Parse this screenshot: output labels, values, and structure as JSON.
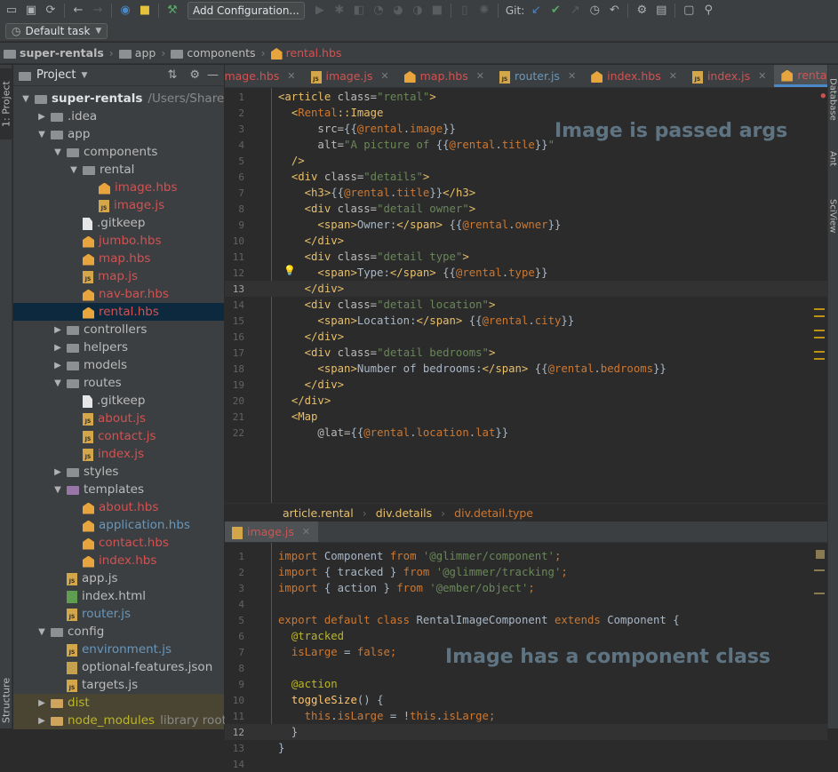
{
  "toolbar": {
    "add_configuration": "Add Configuration...",
    "git_label": "Git:"
  },
  "task": {
    "label": "Default task"
  },
  "breadcrumb": [
    "super-rentals",
    "app",
    "components",
    "rental.hbs"
  ],
  "left_strip": {
    "project_tab": "1: Project",
    "structure_tab": "Structure"
  },
  "right_strip": {
    "database": "Database",
    "ant": "Ant",
    "sciview": "SciView"
  },
  "project_panel": {
    "title": "Project"
  },
  "tree": [
    {
      "label": "super-rentals",
      "extra": "/Users/Shared/",
      "depth": 0,
      "arrow": "open",
      "icon": "folder",
      "color": "bold"
    },
    {
      "label": ".idea",
      "depth": 1,
      "arrow": "closed",
      "icon": "folder",
      "color": "plain"
    },
    {
      "label": "app",
      "depth": 1,
      "arrow": "open",
      "icon": "folder",
      "color": "plain"
    },
    {
      "label": "components",
      "depth": 2,
      "arrow": "open",
      "icon": "folder",
      "color": "plain"
    },
    {
      "label": "rental",
      "depth": 3,
      "arrow": "open",
      "icon": "folder",
      "color": "plain"
    },
    {
      "label": "image.hbs",
      "depth": 4,
      "arrow": "none",
      "icon": "hbs",
      "color": "red"
    },
    {
      "label": "image.js",
      "depth": 4,
      "arrow": "none",
      "icon": "js",
      "color": "red"
    },
    {
      "label": ".gitkeep",
      "depth": 3,
      "arrow": "none",
      "icon": "plain",
      "color": "plain"
    },
    {
      "label": "jumbo.hbs",
      "depth": 3,
      "arrow": "none",
      "icon": "hbs",
      "color": "red"
    },
    {
      "label": "map.hbs",
      "depth": 3,
      "arrow": "none",
      "icon": "hbs",
      "color": "red"
    },
    {
      "label": "map.js",
      "depth": 3,
      "arrow": "none",
      "icon": "js",
      "color": "red"
    },
    {
      "label": "nav-bar.hbs",
      "depth": 3,
      "arrow": "none",
      "icon": "hbs",
      "color": "red"
    },
    {
      "label": "rental.hbs",
      "depth": 3,
      "arrow": "none",
      "icon": "hbs",
      "color": "red",
      "selected": true
    },
    {
      "label": "controllers",
      "depth": 2,
      "arrow": "closed",
      "icon": "folder",
      "color": "plain"
    },
    {
      "label": "helpers",
      "depth": 2,
      "arrow": "closed",
      "icon": "folder",
      "color": "plain"
    },
    {
      "label": "models",
      "depth": 2,
      "arrow": "closed",
      "icon": "folder",
      "color": "plain"
    },
    {
      "label": "routes",
      "depth": 2,
      "arrow": "open",
      "icon": "folder",
      "color": "plain"
    },
    {
      "label": ".gitkeep",
      "depth": 3,
      "arrow": "none",
      "icon": "plain",
      "color": "plain"
    },
    {
      "label": "about.js",
      "depth": 3,
      "arrow": "none",
      "icon": "js",
      "color": "red"
    },
    {
      "label": "contact.js",
      "depth": 3,
      "arrow": "none",
      "icon": "js",
      "color": "red"
    },
    {
      "label": "index.js",
      "depth": 3,
      "arrow": "none",
      "icon": "js",
      "color": "red"
    },
    {
      "label": "styles",
      "depth": 2,
      "arrow": "closed",
      "icon": "folder",
      "color": "plain"
    },
    {
      "label": "templates",
      "depth": 2,
      "arrow": "open",
      "icon": "folder-purple",
      "color": "plain"
    },
    {
      "label": "about.hbs",
      "depth": 3,
      "arrow": "none",
      "icon": "hbs",
      "color": "red"
    },
    {
      "label": "application.hbs",
      "depth": 3,
      "arrow": "none",
      "icon": "hbs",
      "color": "blue"
    },
    {
      "label": "contact.hbs",
      "depth": 3,
      "arrow": "none",
      "icon": "hbs",
      "color": "red"
    },
    {
      "label": "index.hbs",
      "depth": 3,
      "arrow": "none",
      "icon": "hbs",
      "color": "red"
    },
    {
      "label": "app.js",
      "depth": 2,
      "arrow": "none",
      "icon": "js",
      "color": "plain"
    },
    {
      "label": "index.html",
      "depth": 2,
      "arrow": "none",
      "icon": "html",
      "color": "plain"
    },
    {
      "label": "router.js",
      "depth": 2,
      "arrow": "none",
      "icon": "js",
      "color": "blue"
    },
    {
      "label": "config",
      "depth": 1,
      "arrow": "open",
      "icon": "folder",
      "color": "plain"
    },
    {
      "label": "environment.js",
      "depth": 2,
      "arrow": "none",
      "icon": "js",
      "color": "blue"
    },
    {
      "label": "optional-features.json",
      "depth": 2,
      "arrow": "none",
      "icon": "json",
      "color": "plain"
    },
    {
      "label": "targets.js",
      "depth": 2,
      "arrow": "none",
      "icon": "js",
      "color": "plain"
    },
    {
      "label": "dist",
      "depth": 1,
      "arrow": "closed",
      "icon": "folder-orange",
      "color": "yellow",
      "excluded": true
    },
    {
      "label": "node_modules",
      "extra": "library root",
      "depth": 1,
      "arrow": "closed",
      "icon": "folder-orange",
      "color": "yellow",
      "excluded": true
    }
  ],
  "tabs": [
    {
      "label": "image.hbs",
      "icon": "hbs",
      "color": "red",
      "partial": true
    },
    {
      "label": "image.js",
      "icon": "js",
      "color": "red"
    },
    {
      "label": "map.hbs",
      "icon": "hbs",
      "color": "red"
    },
    {
      "label": "router.js",
      "icon": "js",
      "color": "blue"
    },
    {
      "label": "index.hbs",
      "icon": "hbs",
      "color": "red"
    },
    {
      "label": "index.js",
      "icon": "js",
      "color": "red"
    },
    {
      "label": "rental.hbs",
      "icon": "hbs",
      "color": "red",
      "active": true
    }
  ],
  "tab_overflow": "3",
  "top_code": {
    "annotation": "Image is passed args",
    "current_line": 13,
    "lines": [
      [
        [
          "tag",
          "<article "
        ],
        [
          "attr",
          "class="
        ],
        [
          "str",
          "\"rental\""
        ],
        [
          "tag",
          ">"
        ]
      ],
      [
        [
          "plain",
          "  "
        ],
        [
          "tag",
          "<"
        ],
        [
          "comp",
          "Rental"
        ],
        [
          "tag",
          "::Image"
        ]
      ],
      [
        [
          "plain",
          "      "
        ],
        [
          "attr",
          "src="
        ],
        [
          "plain",
          "{{"
        ],
        [
          "arg",
          "@rental"
        ],
        [
          "plain",
          "."
        ],
        [
          "hb",
          "image"
        ],
        [
          "plain",
          "}}"
        ]
      ],
      [
        [
          "plain",
          "      "
        ],
        [
          "attr",
          "alt="
        ],
        [
          "str",
          "\"A picture of "
        ],
        [
          "plain",
          "{{"
        ],
        [
          "arg",
          "@rental"
        ],
        [
          "plain",
          "."
        ],
        [
          "hb",
          "title"
        ],
        [
          "plain",
          "}}"
        ],
        [
          "str",
          "\""
        ]
      ],
      [
        [
          "plain",
          "  "
        ],
        [
          "tag",
          "/>"
        ]
      ],
      [
        [
          "plain",
          "  "
        ],
        [
          "tag",
          "<div "
        ],
        [
          "attr",
          "class="
        ],
        [
          "str",
          "\"details\""
        ],
        [
          "tag",
          ">"
        ]
      ],
      [
        [
          "plain",
          "    "
        ],
        [
          "tag",
          "<h3>"
        ],
        [
          "plain",
          "{{"
        ],
        [
          "arg",
          "@rental"
        ],
        [
          "plain",
          "."
        ],
        [
          "hb",
          "title"
        ],
        [
          "plain",
          "}}"
        ],
        [
          "tag",
          "</h3>"
        ]
      ],
      [
        [
          "plain",
          "    "
        ],
        [
          "tag",
          "<div "
        ],
        [
          "attr",
          "class="
        ],
        [
          "str",
          "\"detail owner\""
        ],
        [
          "tag",
          ">"
        ]
      ],
      [
        [
          "plain",
          "      "
        ],
        [
          "tag",
          "<span>"
        ],
        [
          "plain",
          "Owner:"
        ],
        [
          "tag",
          "</span>"
        ],
        [
          "plain",
          " {{"
        ],
        [
          "arg",
          "@rental"
        ],
        [
          "plain",
          "."
        ],
        [
          "hb",
          "owner"
        ],
        [
          "plain",
          "}}"
        ]
      ],
      [
        [
          "plain",
          "    "
        ],
        [
          "tag",
          "</div>"
        ]
      ],
      [
        [
          "plain",
          "    "
        ],
        [
          "tag",
          "<div "
        ],
        [
          "attr",
          "class="
        ],
        [
          "str",
          "\"detail type\""
        ],
        [
          "tag",
          ">"
        ]
      ],
      [
        [
          "plain",
          "      "
        ],
        [
          "tag",
          "<span>"
        ],
        [
          "plain",
          "Type:"
        ],
        [
          "tag",
          "</span>"
        ],
        [
          "plain",
          " {{"
        ],
        [
          "arg",
          "@rental"
        ],
        [
          "plain",
          "."
        ],
        [
          "hb",
          "type"
        ],
        [
          "plain",
          "}}"
        ]
      ],
      [
        [
          "plain",
          "    "
        ],
        [
          "tag",
          "</div>"
        ]
      ],
      [
        [
          "plain",
          "    "
        ],
        [
          "tag",
          "<div "
        ],
        [
          "attr",
          "class="
        ],
        [
          "str",
          "\"detail location\""
        ],
        [
          "tag",
          ">"
        ]
      ],
      [
        [
          "plain",
          "      "
        ],
        [
          "tag",
          "<span>"
        ],
        [
          "plain",
          "Location:"
        ],
        [
          "tag",
          "</span>"
        ],
        [
          "plain",
          " {{"
        ],
        [
          "arg",
          "@rental"
        ],
        [
          "plain",
          "."
        ],
        [
          "hb",
          "city"
        ],
        [
          "plain",
          "}}"
        ]
      ],
      [
        [
          "plain",
          "    "
        ],
        [
          "tag",
          "</div>"
        ]
      ],
      [
        [
          "plain",
          "    "
        ],
        [
          "tag",
          "<div "
        ],
        [
          "attr",
          "class="
        ],
        [
          "str",
          "\"detail bedrooms\""
        ],
        [
          "tag",
          ">"
        ]
      ],
      [
        [
          "plain",
          "      "
        ],
        [
          "tag",
          "<span>"
        ],
        [
          "plain",
          "Number of bedrooms:"
        ],
        [
          "tag",
          "</span>"
        ],
        [
          "plain",
          " {{"
        ],
        [
          "arg",
          "@rental"
        ],
        [
          "plain",
          "."
        ],
        [
          "hb",
          "bedrooms"
        ],
        [
          "plain",
          "}}"
        ]
      ],
      [
        [
          "plain",
          "    "
        ],
        [
          "tag",
          "</div>"
        ]
      ],
      [
        [
          "plain",
          "  "
        ],
        [
          "tag",
          "</div>"
        ]
      ],
      [
        [
          "plain",
          "  "
        ],
        [
          "tag",
          "<Map"
        ]
      ],
      [
        [
          "plain",
          "      "
        ],
        [
          "attr",
          "@lat="
        ],
        [
          "plain",
          "{{"
        ],
        [
          "arg",
          "@rental"
        ],
        [
          "plain",
          "."
        ],
        [
          "hb",
          "location"
        ],
        [
          "plain",
          "."
        ],
        [
          "hb",
          "lat"
        ],
        [
          "plain",
          "}}"
        ]
      ]
    ]
  },
  "code_breadcrumb": [
    "article.rental",
    "div.details",
    "div.detail.type"
  ],
  "bottom_tab": "image.js",
  "bottom_code": {
    "annotation": "Image has a component class",
    "current_line": 12,
    "lines": [
      [
        [
          "kw",
          "import "
        ],
        [
          "plain",
          "Component "
        ],
        [
          "kw",
          "from "
        ],
        [
          "strg",
          "'@glimmer/component'"
        ],
        [
          "kw",
          ";"
        ]
      ],
      [
        [
          "kw",
          "import "
        ],
        [
          "plain",
          "{ tracked } "
        ],
        [
          "kw",
          "from "
        ],
        [
          "strg",
          "'@glimmer/tracking'"
        ],
        [
          "kw",
          ";"
        ]
      ],
      [
        [
          "kw",
          "import "
        ],
        [
          "plain",
          "{ action } "
        ],
        [
          "kw",
          "from "
        ],
        [
          "strg",
          "'@ember/object'"
        ],
        [
          "kw",
          ";"
        ]
      ],
      [],
      [
        [
          "kw",
          "export default class "
        ],
        [
          "plain",
          "RentalImageComponent "
        ],
        [
          "kw",
          "extends "
        ],
        [
          "plain",
          "Component {"
        ]
      ],
      [
        [
          "plain",
          "  "
        ],
        [
          "ann",
          "@tracked"
        ]
      ],
      [
        [
          "plain",
          "  "
        ],
        [
          "hb",
          "isLarge"
        ],
        [
          "plain",
          " = "
        ],
        [
          "kw",
          "false"
        ],
        [
          "kw",
          ";"
        ]
      ],
      [],
      [
        [
          "plain",
          "  "
        ],
        [
          "ann",
          "@action"
        ]
      ],
      [
        [
          "plain",
          "  "
        ],
        [
          "name",
          "toggleSize"
        ],
        [
          "plain",
          "() {"
        ]
      ],
      [
        [
          "plain",
          "    "
        ],
        [
          "kw",
          "this"
        ],
        [
          "plain",
          "."
        ],
        [
          "hb",
          "isLarge"
        ],
        [
          "plain",
          " = !"
        ],
        [
          "kw",
          "this"
        ],
        [
          "plain",
          "."
        ],
        [
          "hb",
          "isLarge"
        ],
        [
          "kw",
          ";"
        ]
      ],
      [
        [
          "plain",
          "  }"
        ]
      ],
      [
        [
          "plain",
          "}"
        ]
      ],
      []
    ]
  }
}
